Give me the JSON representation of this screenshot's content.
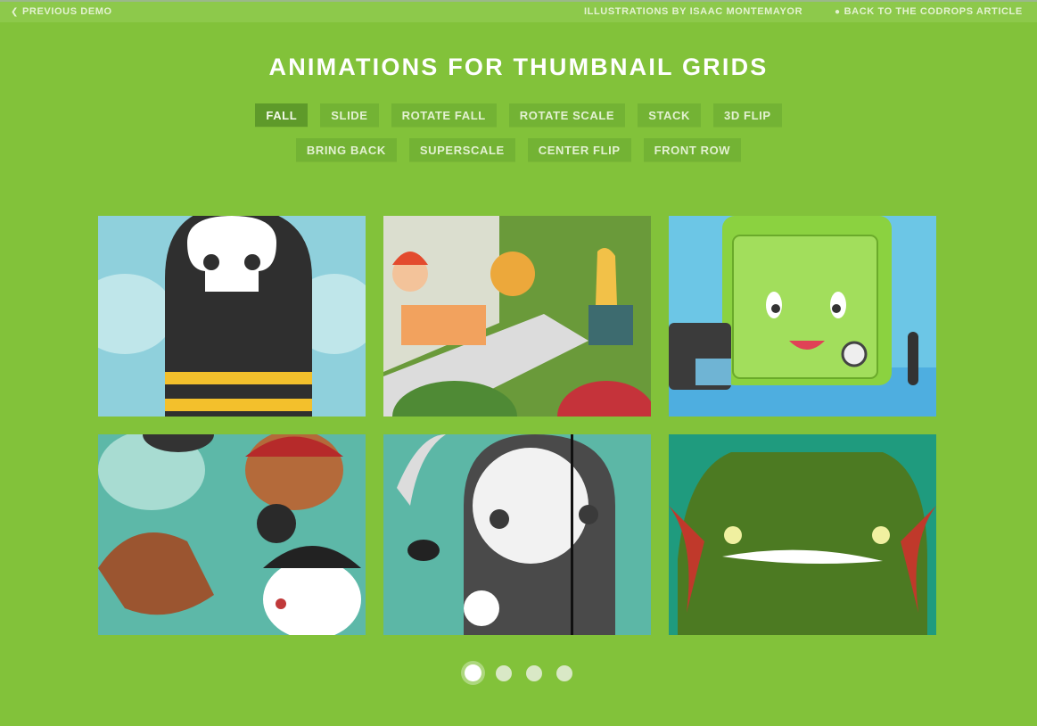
{
  "topbar": {
    "previous_demo": "PREVIOUS DEMO",
    "credits": "ILLUSTRATIONS BY ISAAC MONTEMAYOR",
    "back_article": "BACK TO THE CODROPS ARTICLE",
    "icons": {
      "previous": "arrow-left-icon",
      "back": "drop-icon"
    }
  },
  "header": {
    "title": "ANIMATIONS FOR THUMBNAIL GRIDS"
  },
  "effects": {
    "row1": [
      "FALL",
      "SLIDE",
      "ROTATE FALL",
      "ROTATE SCALE",
      "STACK",
      "3D FLIP"
    ],
    "row2": [
      "BRING BACK",
      "SUPERSCALE",
      "CENTER FLIP",
      "FRONT ROW"
    ],
    "active": "FALL"
  },
  "grid": {
    "thumbnails": [
      {
        "subject": "skull bee character"
      },
      {
        "subject": "office workers scene"
      },
      {
        "subject": "green safe character with camera"
      },
      {
        "subject": "pirate creatures"
      },
      {
        "subject": "grim reaper character"
      },
      {
        "subject": "green monster"
      }
    ]
  },
  "pagination": {
    "pages": 4,
    "current": 1
  }
}
